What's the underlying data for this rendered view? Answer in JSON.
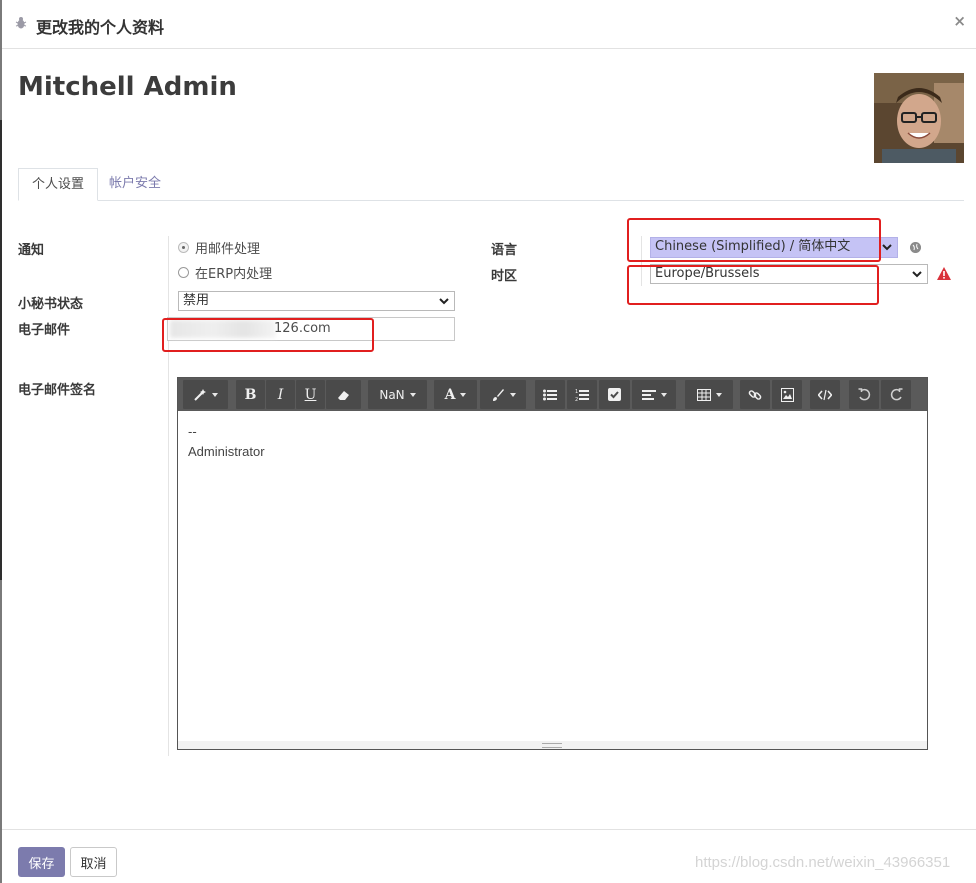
{
  "dialog": {
    "title": "更改我的个人资料",
    "close_glyph": "×"
  },
  "user": {
    "name": "Mitchell Admin",
    "avatar_icon": "user-photo"
  },
  "tabs": [
    {
      "label": "个人设置",
      "active": true
    },
    {
      "label": "帐户安全",
      "active": false
    }
  ],
  "form": {
    "notification": {
      "label": "通知",
      "options": [
        {
          "label": "用邮件处理",
          "checked": true
        },
        {
          "label": "在ERP内处理",
          "checked": false
        }
      ]
    },
    "odoobot": {
      "label": "小秘书状态",
      "value": "禁用"
    },
    "email": {
      "label": "电子邮件",
      "value": "126.com"
    },
    "language": {
      "label": "语言",
      "value": "Chinese (Simplified) / 简体中文"
    },
    "timezone": {
      "label": "时区",
      "value": "Europe/Brussels"
    },
    "signature": {
      "label": "电子邮件签名",
      "lines": [
        "--",
        "Administrator"
      ]
    }
  },
  "toolbar": {
    "font_size_label": "NaN"
  },
  "footer": {
    "save_label": "保存",
    "cancel_label": "取消"
  },
  "watermark": "https://blog.csdn.net/weixin_43966351",
  "colors": {
    "primary": "#7c7bad",
    "highlight": "#e11f1f",
    "language_select": "#c5c3f5"
  }
}
